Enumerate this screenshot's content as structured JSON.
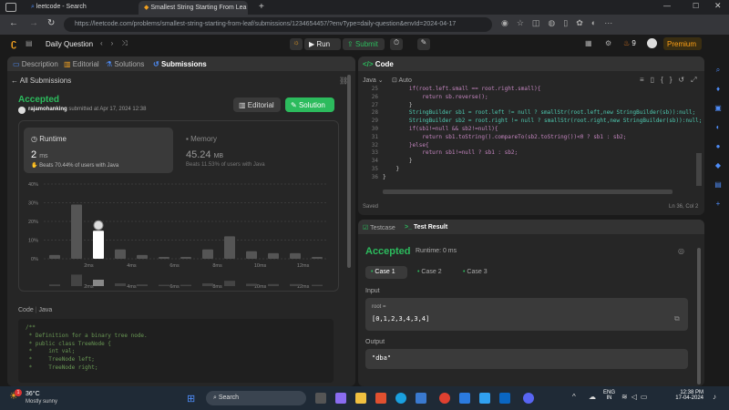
{
  "browser": {
    "tabs": [
      {
        "title": "leetcode - Search"
      },
      {
        "title": "Smallest String Starting From Lea"
      }
    ],
    "url": "https://leetcode.com/problems/smallest-string-starting-from-leaf/submissions/1234654457/?envType=daily-question&envId=2024-04-17"
  },
  "topbar": {
    "title": "Daily Question",
    "run": "Run",
    "submit": "Submit",
    "streak": "9",
    "premium": "Premium"
  },
  "left": {
    "tabs": [
      "Description",
      "Editorial",
      "Solutions",
      "Submissions"
    ],
    "back": "All Submissions",
    "status": "Accepted",
    "user": "rajamohanking",
    "submitted": "submitted at Apr 17, 2024 12:38",
    "editorial_btn": "Editorial",
    "solution_btn": "Solution",
    "runtime": {
      "label": "Runtime",
      "value": "2",
      "unit": "ms",
      "beats": "Beats 70.44% of users with Java"
    },
    "memory": {
      "label": "Memory",
      "value": "45.24",
      "unit": "MB",
      "beats": "Beats 11.53% of users with Java"
    },
    "chart": {
      "y_ticks": [
        "40%",
        "30%",
        "20%",
        "10%",
        "0%"
      ],
      "x_ticks": [
        "2ms",
        "4ms",
        "6ms",
        "8ms",
        "10ms",
        "12ms"
      ]
    },
    "code_label": "Code",
    "lang": "Java",
    "code_lines": [
      "/**",
      " * Definition for a binary tree node.",
      " * public class TreeNode {",
      " *     int val;",
      " *     TreeNode left;",
      " *     TreeNode right;"
    ]
  },
  "chart_data": {
    "type": "bar",
    "categories": [
      "1",
      "2",
      "3",
      "4",
      "5",
      "6",
      "7",
      "8",
      "9",
      "10",
      "11",
      "12",
      "13"
    ],
    "values": [
      2,
      29,
      15,
      5,
      2,
      1,
      1,
      5,
      12,
      4,
      3,
      3,
      1
    ],
    "ylim": [
      0,
      40
    ],
    "highlight": "3"
  },
  "editor": {
    "title": "Code",
    "lang": "Java",
    "mode": "Auto",
    "line_numbers": [
      "25",
      "26",
      "27",
      "28",
      "29",
      "30",
      "31",
      "32",
      "33",
      "34",
      "35",
      "36"
    ],
    "lines": [
      "        if(root.left.small == root.right.small){",
      "            return sb.reverse();",
      "        }",
      "        StringBuilder sb1 = root.left != null ? smallStr(root.left,new StringBuilder(sb)):null;",
      "        StringBuilder sb2 = root.right != null ? smallStr(root.right,new StringBuilder(sb)):null;",
      "        if(sb1!=null && sb2!=null){",
      "            return sb1.toString().compareTo(sb2.toString())<0 ? sb1 : sb2;",
      "        }else{",
      "            return sb1!=null ? sb1 : sb2;",
      "        }",
      "    }",
      "}"
    ],
    "saved": "Saved",
    "pos": "Ln 36, Col 2"
  },
  "tests": {
    "tabs": [
      "Testcase",
      "Test Result"
    ],
    "status": "Accepted",
    "runtime": "Runtime: 0 ms",
    "cases": [
      "Case 1",
      "Case 2",
      "Case 3"
    ],
    "input_label": "Input",
    "param": "root =",
    "value": "[0,1,2,3,4,3,4]",
    "output_label": "Output",
    "output": "\"dba\""
  },
  "taskbar": {
    "temp": "36°C",
    "weather": "Mostly sunny",
    "search": "Search",
    "lang1": "ENG",
    "lang2": "IN",
    "time": "12:38 PM",
    "date": "17-04-2024",
    "badge": "1"
  }
}
